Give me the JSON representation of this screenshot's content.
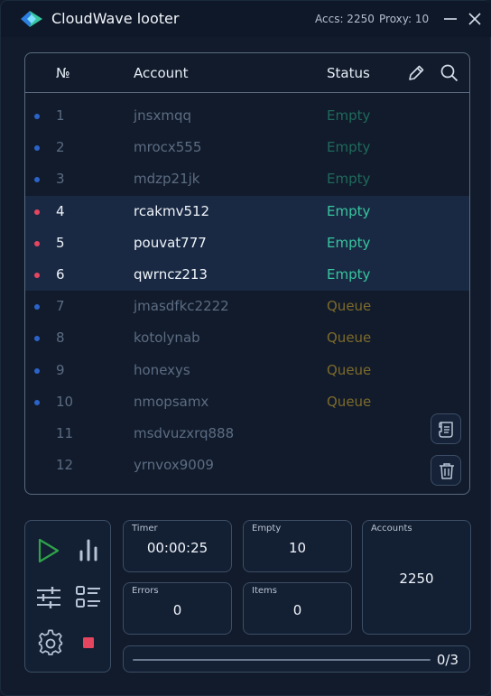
{
  "app": {
    "title": "CloudWave looter",
    "accs": "Accs: 2250",
    "proxy": "Proxy: 10"
  },
  "table": {
    "headers": {
      "num": "№",
      "account": "Account",
      "status": "Status"
    },
    "rows": [
      {
        "num": "1",
        "account": "jnsxmqq",
        "status": "Empty",
        "dot": "#2b63c9",
        "status_color": "#1f6a5c",
        "selected": false
      },
      {
        "num": "2",
        "account": "mrocx555",
        "status": "Empty",
        "dot": "#2b63c9",
        "status_color": "#1f6a5c",
        "selected": false
      },
      {
        "num": "3",
        "account": "mdzp21jk",
        "status": "Empty",
        "dot": "#2b63c9",
        "status_color": "#1f6a5c",
        "selected": false
      },
      {
        "num": "4",
        "account": "rcakmv512",
        "status": "Empty",
        "dot": "#e64560",
        "status_color": "#37c6a0",
        "selected": true
      },
      {
        "num": "5",
        "account": "pouvat777",
        "status": "Empty",
        "dot": "#e64560",
        "status_color": "#37c6a0",
        "selected": true
      },
      {
        "num": "6",
        "account": "qwrncz213",
        "status": "Empty",
        "dot": "#e64560",
        "status_color": "#37c6a0",
        "selected": true
      },
      {
        "num": "7",
        "account": "jmasdfkc2222",
        "status": "Queue",
        "dot": "#2b63c9",
        "status_color": "#7d6a2b",
        "selected": false
      },
      {
        "num": "8",
        "account": "kotolynab",
        "status": "Queue",
        "dot": "#2b63c9",
        "status_color": "#7d6a2b",
        "selected": false
      },
      {
        "num": "9",
        "account": "honexys",
        "status": "Queue",
        "dot": "#2b63c9",
        "status_color": "#7d6a2b",
        "selected": false
      },
      {
        "num": "10",
        "account": "nmopsamx",
        "status": "Queue",
        "dot": "#2b63c9",
        "status_color": "#7d6a2b",
        "selected": false
      },
      {
        "num": "11",
        "account": "msdvuzxrq888",
        "status": "",
        "dot": "",
        "status_color": "#7d6a2b",
        "selected": false
      },
      {
        "num": "12",
        "account": "yrnvox9009",
        "status": "",
        "dot": "",
        "status_color": "#7d6a2b",
        "selected": false
      }
    ]
  },
  "stats": {
    "timer": {
      "label": "Timer",
      "value": "00:00:25"
    },
    "empty": {
      "label": "Empty",
      "value": "10"
    },
    "accounts": {
      "label": "Accounts",
      "value": "2250"
    },
    "errors": {
      "label": "Errors",
      "value": "0"
    },
    "items": {
      "label": "Items",
      "value": "0"
    }
  },
  "progress": {
    "text": "0/3",
    "fraction": 0
  },
  "colors": {
    "accent_green": "#2fa34a",
    "stop_red": "#e64560",
    "icon": "#b7c3d4"
  }
}
